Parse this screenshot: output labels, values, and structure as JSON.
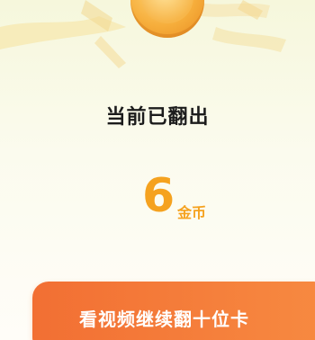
{
  "reward": {
    "title": "当前已翻出",
    "amount": "6",
    "unit": "金币"
  },
  "cta": {
    "label": "看视频继续翻十位卡"
  },
  "colors": {
    "accent": "#f5a21f",
    "button": "#f37736",
    "background": "#f8f8e4"
  },
  "icons": {
    "coin": "gold-coin-icon",
    "ribbons": "confetti-ribbons"
  }
}
